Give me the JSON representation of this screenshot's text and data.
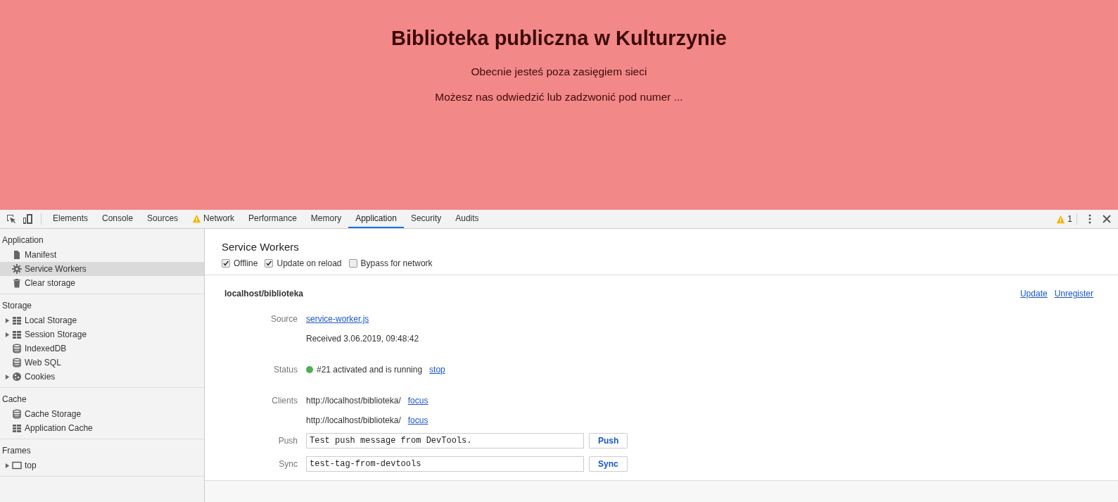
{
  "page": {
    "title": "Biblioteka publiczna w Kulturzynie",
    "paragraphs": [
      "Obecnie jesteś poza zasięgiem sieci",
      "Możesz nas odwiedzić lub zadzwonić pod numer ..."
    ]
  },
  "devtools": {
    "tabs": [
      {
        "label": "Elements",
        "selected": false,
        "warning": false
      },
      {
        "label": "Console",
        "selected": false,
        "warning": false
      },
      {
        "label": "Sources",
        "selected": false,
        "warning": false
      },
      {
        "label": "Network",
        "selected": false,
        "warning": true
      },
      {
        "label": "Performance",
        "selected": false,
        "warning": false
      },
      {
        "label": "Memory",
        "selected": false,
        "warning": false
      },
      {
        "label": "Application",
        "selected": true,
        "warning": false
      },
      {
        "label": "Security",
        "selected": false,
        "warning": false
      },
      {
        "label": "Audits",
        "selected": false,
        "warning": false
      }
    ],
    "warning_count": "1",
    "sidebar": [
      {
        "heading": "Application",
        "items": [
          {
            "label": "Manifest",
            "kind": "file",
            "selected": false
          },
          {
            "label": "Service Workers",
            "kind": "gear",
            "selected": true
          },
          {
            "label": "Clear storage",
            "kind": "trash",
            "selected": false
          }
        ]
      },
      {
        "heading": "Storage",
        "items": [
          {
            "label": "Local Storage",
            "kind": "grid",
            "selected": false,
            "expanded": false
          },
          {
            "label": "Session Storage",
            "kind": "grid",
            "selected": false,
            "expanded": false
          },
          {
            "label": "IndexedDB",
            "kind": "database",
            "selected": false
          },
          {
            "label": "Web SQL",
            "kind": "database",
            "selected": false
          },
          {
            "label": "Cookies",
            "kind": "cookie",
            "selected": false,
            "expanded": false
          }
        ]
      },
      {
        "heading": "Cache",
        "items": [
          {
            "label": "Cache Storage",
            "kind": "database",
            "selected": false
          },
          {
            "label": "Application Cache",
            "kind": "grid",
            "selected": false
          }
        ]
      },
      {
        "heading": "Frames",
        "items": [
          {
            "label": "top",
            "kind": "frame",
            "selected": false,
            "expanded": false
          }
        ]
      }
    ],
    "panel": {
      "title": "Service Workers",
      "options": [
        {
          "label": "Offline",
          "checked": true
        },
        {
          "label": "Update on reload",
          "checked": true
        },
        {
          "label": "Bypass for network",
          "checked": false
        }
      ],
      "worker": {
        "scope": "localhost/biblioteka",
        "actions": [
          "Update",
          "Unregister"
        ],
        "source": {
          "label": "Source",
          "file": "service-worker.js",
          "received": "Received 3.06.2019, 09:48:42"
        },
        "status": {
          "label": "Status",
          "color": "#4caf50",
          "text": "#21 activated and is running",
          "action": "stop"
        },
        "clients": {
          "label": "Clients",
          "items": [
            {
              "url": "http://localhost/biblioteka/",
              "action": "focus"
            },
            {
              "url": "http://localhost/biblioteka/",
              "action": "focus"
            }
          ]
        },
        "push": {
          "label": "Push",
          "value": "Test push message from DevTools.",
          "button": "Push"
        },
        "sync": {
          "label": "Sync",
          "value": "test-tag-from-devtools",
          "button": "Sync"
        }
      }
    }
  }
}
